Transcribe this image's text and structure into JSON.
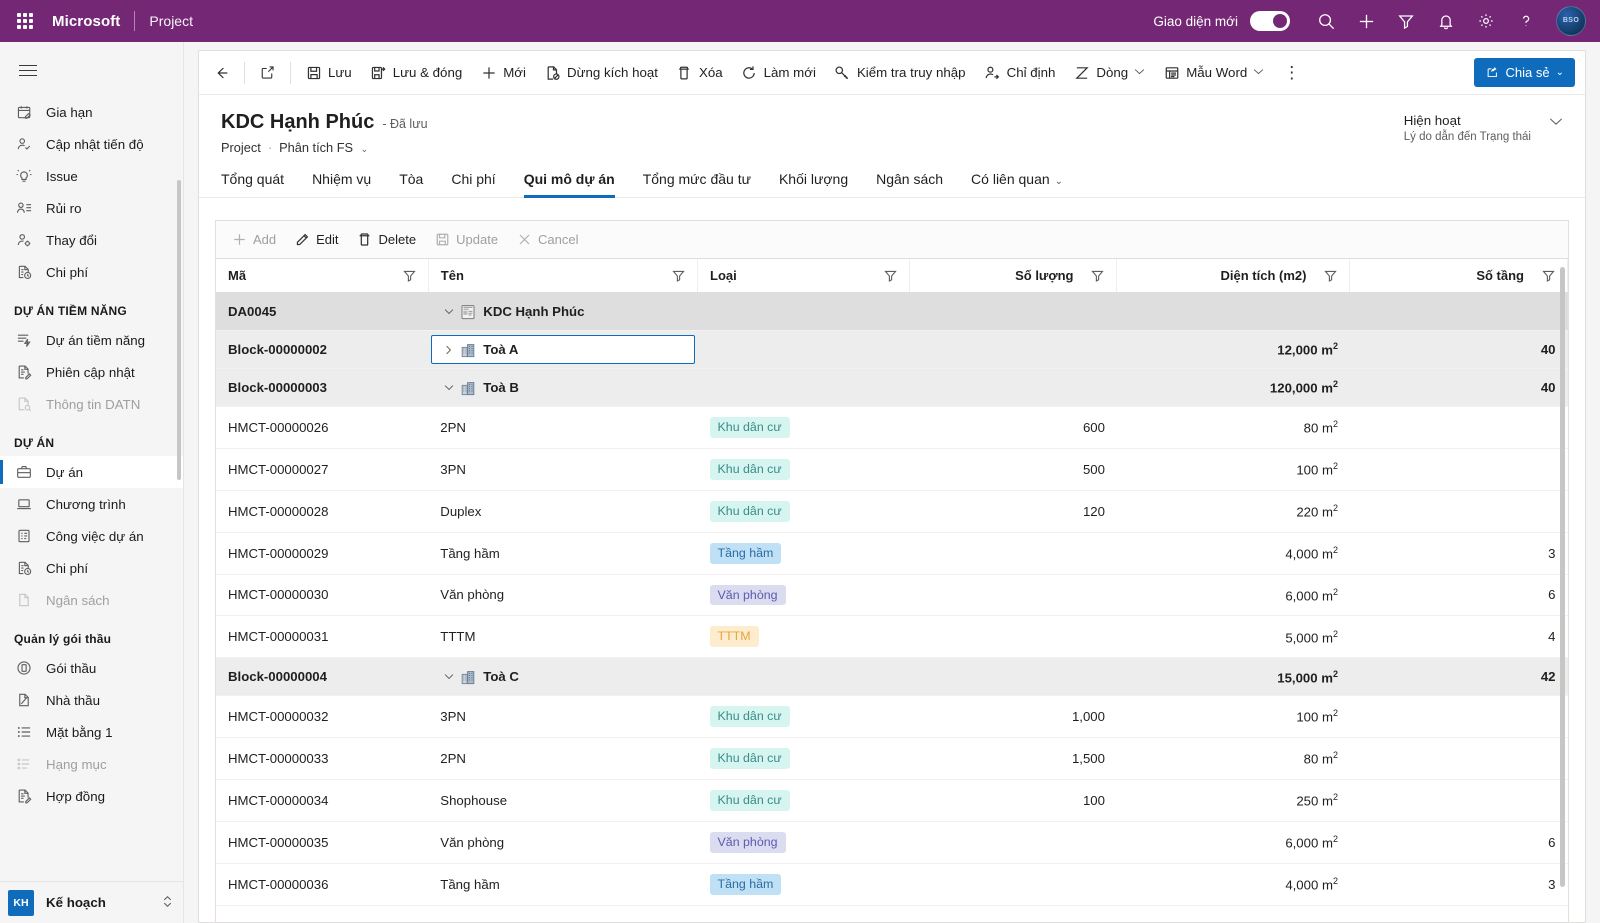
{
  "topbar": {
    "brand": "Microsoft",
    "app_name": "Project",
    "new_ui_label": "Giao diện mới",
    "toggle_on": true,
    "icons": [
      "search-icon",
      "plus-icon",
      "filter-icon",
      "bell-icon",
      "gear-icon",
      "help-icon"
    ],
    "avatar_initials": "BSO"
  },
  "sidebar": {
    "sections": [
      {
        "title": "",
        "items": [
          {
            "label": "Gia hạn",
            "icon": "calendar-edit-icon",
            "active": false,
            "muted": false
          },
          {
            "label": "Cập nhật tiến độ",
            "icon": "person-check-icon",
            "active": false,
            "muted": false
          },
          {
            "label": "Issue",
            "icon": "lightbulb-alert-icon",
            "active": false,
            "muted": false
          },
          {
            "label": "Rủi ro",
            "icon": "person-list-icon",
            "active": false,
            "muted": false
          },
          {
            "label": "Thay đổi",
            "icon": "person-gear-icon",
            "active": false,
            "muted": false
          },
          {
            "label": "Chi phí",
            "icon": "document-clock-icon",
            "active": false,
            "muted": false
          }
        ]
      },
      {
        "title": "DỰ ÁN TIỀM NĂNG",
        "items": [
          {
            "label": "Dự án tiềm năng",
            "icon": "flash-list-icon",
            "active": false,
            "muted": false
          },
          {
            "label": "Phiên cập nhật",
            "icon": "document-edit-icon",
            "active": false,
            "muted": false
          },
          {
            "label": "Thông tin DATN",
            "icon": "document-search-icon",
            "active": false,
            "muted": true
          }
        ]
      },
      {
        "title": "DỰ ÁN",
        "items": [
          {
            "label": "Dự án",
            "icon": "briefcase-icon",
            "active": true,
            "muted": false
          },
          {
            "label": "Chương trình",
            "icon": "laptop-icon",
            "active": false,
            "muted": false
          },
          {
            "label": "Công việc dự án",
            "icon": "task-list-icon",
            "active": false,
            "muted": false
          },
          {
            "label": "Chi phí",
            "icon": "document-clock-icon",
            "active": false,
            "muted": false
          },
          {
            "label": "Ngân sách",
            "icon": "page-icon",
            "active": false,
            "muted": true
          }
        ]
      },
      {
        "title": "Quản lý gói thầu",
        "items": [
          {
            "label": "Gói thầu",
            "icon": "circle-doc-icon",
            "active": false,
            "muted": false
          },
          {
            "label": "Nhà thầu",
            "icon": "page-fold-icon",
            "active": false,
            "muted": false
          },
          {
            "label": "Mặt bằng 1",
            "icon": "bullet-list-icon",
            "active": false,
            "muted": false
          },
          {
            "label": "Hạng mục",
            "icon": "dotted-list-icon",
            "active": false,
            "muted": true
          },
          {
            "label": "Hợp đồng",
            "icon": "document-edit-icon",
            "active": false,
            "muted": false
          }
        ]
      }
    ],
    "footer": {
      "badge": "KH",
      "label": "Kế hoạch",
      "chevron": "⌃⌄"
    }
  },
  "commandbar": {
    "back": "back-arrow-icon",
    "popout": "popout-icon",
    "items": [
      {
        "label": "Lưu",
        "icon": "save-icon",
        "accent": "#2266bb"
      },
      {
        "label": "Lưu & đóng",
        "icon": "save-close-icon",
        "accent": "#2266bb"
      },
      {
        "label": "Mới",
        "icon": "plus-icon",
        "accent": "#107c41"
      },
      {
        "label": "Dừng kích hoạt",
        "icon": "deactivate-icon",
        "accent": "#d13438"
      },
      {
        "label": "Xóa",
        "icon": "trash-icon",
        "accent": "#323130"
      },
      {
        "label": "Làm mới",
        "icon": "refresh-icon",
        "accent": "#323130"
      },
      {
        "label": "Kiểm tra truy nhập",
        "icon": "key-icon",
        "accent": "#323130"
      },
      {
        "label": "Chỉ định",
        "icon": "assign-person-icon",
        "accent": "#323130"
      },
      {
        "label": "Dòng",
        "icon": "flow-icon",
        "accent": "#323130",
        "chevron": true
      },
      {
        "label": "Mẫu Word",
        "icon": "word-template-icon",
        "accent": "#323130",
        "chevron": true
      }
    ],
    "kebab": "⋮",
    "share": {
      "label": "Chia sẻ",
      "icon": "share-icon",
      "chevron": "⌄",
      "color": "#0f6cbd"
    }
  },
  "record": {
    "title": "KDC Hạnh Phúc",
    "saved_state": "- Đã lưu",
    "entity": "Project",
    "separator": "·",
    "view": "Phân tích FS",
    "view_chevron": "⌄",
    "status_value": "Hiện hoạt",
    "status_label": "Lý do dẫn đến Trạng thái",
    "status_chevron": "⌄"
  },
  "tabs": [
    {
      "label": "Tổng quát",
      "active": false
    },
    {
      "label": "Nhiệm vụ",
      "active": false
    },
    {
      "label": "Tòa",
      "active": false
    },
    {
      "label": "Chi phí",
      "active": false
    },
    {
      "label": "Qui mô dự án",
      "active": true
    },
    {
      "label": "Tổng mức đầu tư",
      "active": false
    },
    {
      "label": "Khối lượng",
      "active": false
    },
    {
      "label": "Ngân sách",
      "active": false
    },
    {
      "label": "Có liên quan",
      "active": false,
      "chevron": "⌄"
    }
  ],
  "grid": {
    "toolbar": [
      {
        "label": "Add",
        "icon": "plus-icon",
        "disabled": true
      },
      {
        "label": "Edit",
        "icon": "pencil-icon",
        "disabled": false
      },
      {
        "label": "Delete",
        "icon": "trash-icon",
        "disabled": false
      },
      {
        "label": "Update",
        "icon": "save-icon",
        "disabled": true
      },
      {
        "label": "Cancel",
        "icon": "close-icon",
        "disabled": true
      }
    ],
    "columns": [
      {
        "label": "Mã",
        "align": "left",
        "filter": true
      },
      {
        "label": "Tên",
        "align": "left",
        "filter": true
      },
      {
        "label": "Loại",
        "align": "left",
        "filter": true
      },
      {
        "label": "Số lượng",
        "align": "right",
        "filter": true
      },
      {
        "label": "Diện tích (m2)",
        "align": "right",
        "filter": true
      },
      {
        "label": "Số tầng",
        "align": "right",
        "filter": true
      }
    ],
    "rows": [
      {
        "code": "DA0045",
        "name": "KDC Hạnh Phúc",
        "level": 0,
        "expanded": true,
        "icon": "project-icon",
        "type": "",
        "type_style": "",
        "qty": "",
        "area": "",
        "area_sup": "",
        "floors": "",
        "focused": false
      },
      {
        "code": "Block-00000002",
        "name": "Toà A",
        "level": 1,
        "expanded": false,
        "icon": "building-icon",
        "type": "",
        "type_style": "",
        "qty": "",
        "area": "12,000 m",
        "area_sup": "2",
        "floors": "40",
        "focused": true
      },
      {
        "code": "Block-00000003",
        "name": "Toà B",
        "level": 1,
        "expanded": true,
        "icon": "building-icon",
        "type": "",
        "type_style": "",
        "qty": "",
        "area": "120,000 m",
        "area_sup": "2",
        "floors": "40",
        "focused": false
      },
      {
        "code": "HMCT-00000026",
        "name": "2PN",
        "level": 2,
        "icon": "",
        "type": "Khu dân cư",
        "type_style": "b-resi",
        "qty": "600",
        "area": "80 m",
        "area_sup": "2",
        "floors": ""
      },
      {
        "code": "HMCT-00000027",
        "name": "3PN",
        "level": 2,
        "icon": "",
        "type": "Khu dân cư",
        "type_style": "b-resi",
        "qty": "500",
        "area": "100 m",
        "area_sup": "2",
        "floors": ""
      },
      {
        "code": "HMCT-00000028",
        "name": "Duplex",
        "level": 2,
        "icon": "",
        "type": "Khu dân cư",
        "type_style": "b-resi",
        "qty": "120",
        "area": "220 m",
        "area_sup": "2",
        "floors": ""
      },
      {
        "code": "HMCT-00000029",
        "name": "Tầng hầm",
        "level": 2,
        "icon": "",
        "type": "Tầng hầm",
        "type_style": "b-base",
        "qty": "",
        "area": "4,000 m",
        "area_sup": "2",
        "floors": "3"
      },
      {
        "code": "HMCT-00000030",
        "name": "Văn phòng",
        "level": 2,
        "icon": "",
        "type": "Văn phòng",
        "type_style": "b-office",
        "qty": "",
        "area": "6,000 m",
        "area_sup": "2",
        "floors": "6"
      },
      {
        "code": "HMCT-00000031",
        "name": "TTTM",
        "level": 2,
        "icon": "",
        "type": "TTTM",
        "type_style": "b-mall",
        "qty": "",
        "area": "5,000 m",
        "area_sup": "2",
        "floors": "4"
      },
      {
        "code": "Block-00000004",
        "name": "Toà C",
        "level": 1,
        "expanded": true,
        "icon": "building-icon",
        "type": "",
        "type_style": "",
        "qty": "",
        "area": "15,000 m",
        "area_sup": "2",
        "floors": "42",
        "focused": false
      },
      {
        "code": "HMCT-00000032",
        "name": "3PN",
        "level": 2,
        "icon": "",
        "type": "Khu dân cư",
        "type_style": "b-resi",
        "qty": "1,000",
        "area": "100 m",
        "area_sup": "2",
        "floors": ""
      },
      {
        "code": "HMCT-00000033",
        "name": "2PN",
        "level": 2,
        "icon": "",
        "type": "Khu dân cư",
        "type_style": "b-resi",
        "qty": "1,500",
        "area": "80 m",
        "area_sup": "2",
        "floors": ""
      },
      {
        "code": "HMCT-00000034",
        "name": "Shophouse",
        "level": 2,
        "icon": "",
        "type": "Khu dân cư",
        "type_style": "b-resi",
        "qty": "100",
        "area": "250 m",
        "area_sup": "2",
        "floors": ""
      },
      {
        "code": "HMCT-00000035",
        "name": "Văn phòng",
        "level": 2,
        "icon": "",
        "type": "Văn phòng",
        "type_style": "b-office",
        "qty": "",
        "area": "6,000 m",
        "area_sup": "2",
        "floors": "6"
      },
      {
        "code": "HMCT-00000036",
        "name": "Tầng hầm",
        "level": 2,
        "icon": "",
        "type": "Tầng hầm",
        "type_style": "b-base",
        "qty": "",
        "area": "4,000 m",
        "area_sup": "2",
        "floors": "3"
      }
    ]
  },
  "colors": {
    "header_purple": "#742774",
    "accent_blue": "#0f6cbd",
    "group0_bg": "#dedede",
    "group1_bg": "#ededed"
  }
}
